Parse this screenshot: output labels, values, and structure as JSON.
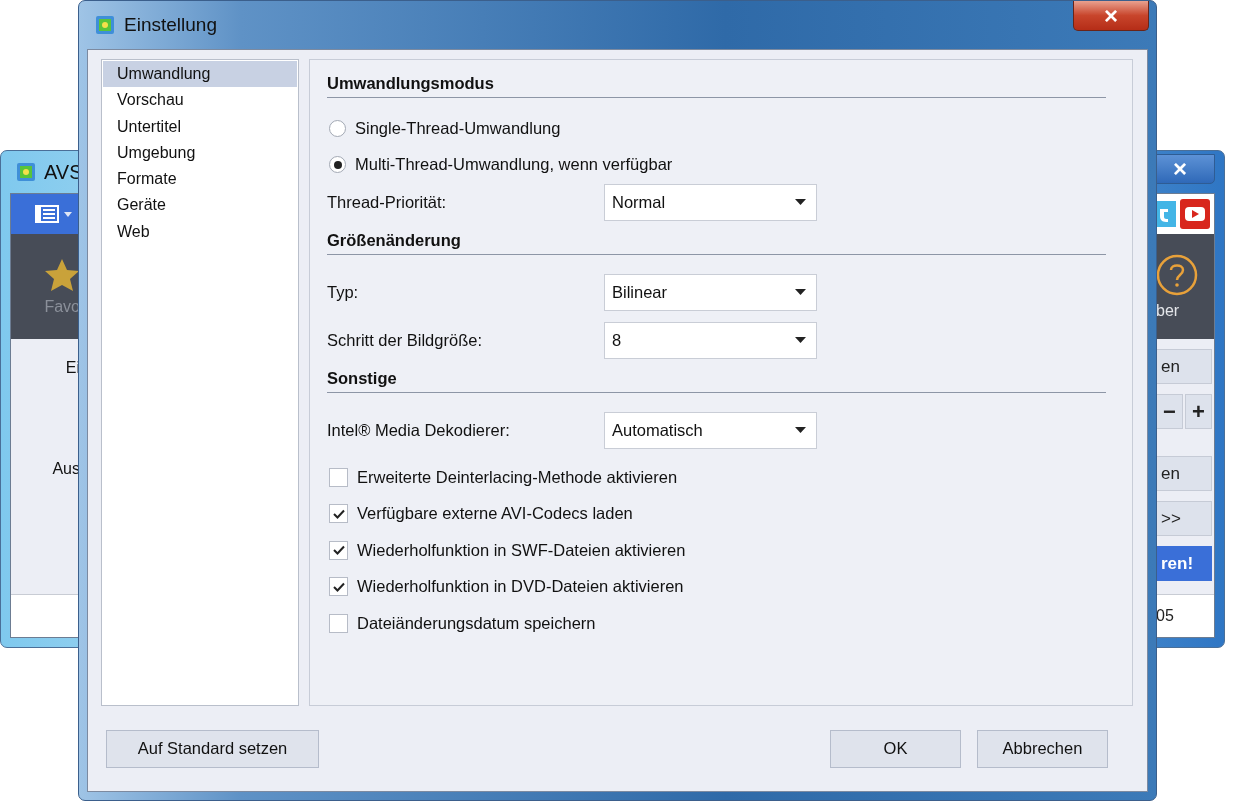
{
  "background_window": {
    "title": "AVS",
    "close_label": "×",
    "left_band_label": "Favo",
    "right_band_label": "ber",
    "left_labels": [
      "Ei",
      "Aus"
    ],
    "right_rows": [
      [
        {
          "label": "en",
          "kind": "plain"
        }
      ],
      [
        {
          "label": "−",
          "kind": "plain"
        },
        {
          "label": "+",
          "kind": "plain"
        }
      ],
      [
        {
          "label": "en",
          "kind": "plain"
        }
      ],
      [
        {
          "label": ">>",
          "kind": "plain"
        }
      ],
      [
        {
          "label": "ren!",
          "kind": "primary"
        }
      ]
    ],
    "status_text": "05"
  },
  "dialog": {
    "title": "Einstellung",
    "close_label": "×",
    "sidebar": {
      "items": [
        {
          "label": "Umwandlung",
          "selected": true
        },
        {
          "label": "Vorschau",
          "selected": false
        },
        {
          "label": "Untertitel",
          "selected": false
        },
        {
          "label": "Umgebung",
          "selected": false
        },
        {
          "label": "Formate",
          "selected": false
        },
        {
          "label": "Geräte",
          "selected": false
        },
        {
          "label": "Web",
          "selected": false
        }
      ]
    },
    "sections": [
      {
        "heading": "Umwandlungsmodus",
        "rows": [
          {
            "kind": "radio",
            "label": "Single-Thread-Umwandlung",
            "selected": false
          },
          {
            "kind": "radio",
            "label": "Multi-Thread-Umwandlung, wenn verfügbar",
            "selected": true
          },
          {
            "kind": "select",
            "label": "Thread-Priorität:",
            "value": "Normal"
          }
        ]
      },
      {
        "heading": "Größenänderung",
        "rows": [
          {
            "kind": "select",
            "label": "Typ:",
            "value": "Bilinear"
          },
          {
            "kind": "select",
            "label": "Schritt der Bildgröße:",
            "value": "8"
          }
        ]
      },
      {
        "heading": "Sonstige",
        "rows": [
          {
            "kind": "select",
            "label": "Intel® Media Dekodierer:",
            "value": "Automatisch"
          },
          {
            "kind": "checkbox",
            "label": "Erweiterte Deinterlacing-Methode aktivieren",
            "checked": false
          },
          {
            "kind": "checkbox",
            "label": "Verfügbare externe AVI-Codecs laden",
            "checked": true
          },
          {
            "kind": "checkbox",
            "label": "Wiederholfunktion in SWF-Dateien aktivieren",
            "checked": true
          },
          {
            "kind": "checkbox",
            "label": "Wiederholfunktion in DVD-Dateien aktivieren",
            "checked": true
          },
          {
            "kind": "checkbox",
            "label": "Dateiänderungsdatum speichern",
            "checked": false
          }
        ]
      }
    ],
    "reset_button": "Auf Standard setzen",
    "buttons": [
      "OK",
      "Abbrechen"
    ]
  }
}
